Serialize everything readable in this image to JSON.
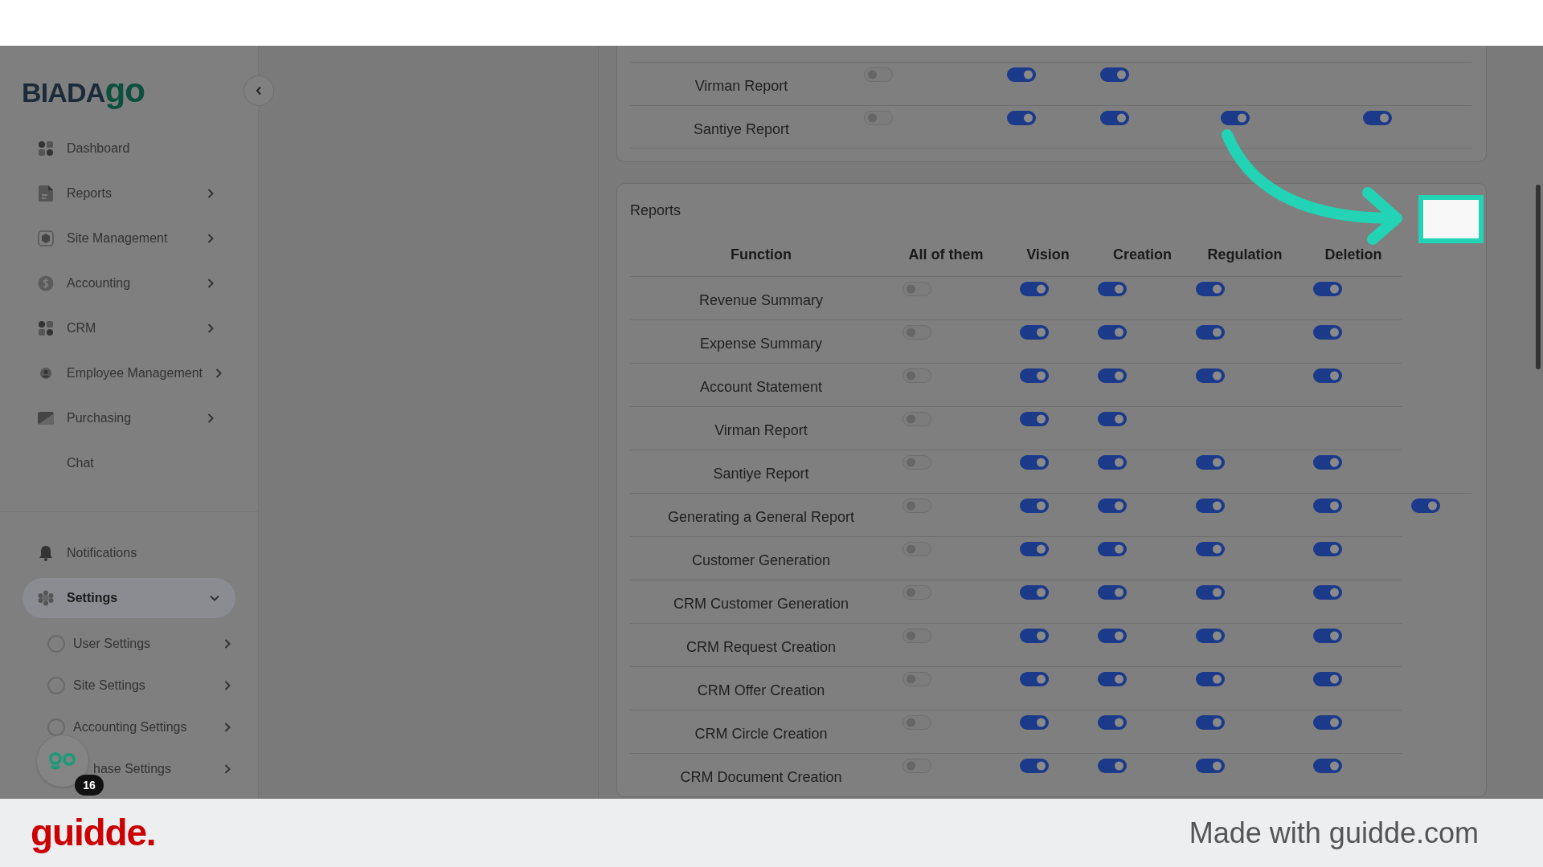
{
  "logo": {
    "text": "BIADA",
    "accent": "go"
  },
  "sidebar": {
    "items": [
      {
        "label": "Dashboard",
        "kind": "grid",
        "expandable": false
      },
      {
        "label": "Reports",
        "kind": "doc",
        "expandable": true
      },
      {
        "label": "Site Management",
        "kind": "box",
        "expandable": true
      },
      {
        "label": "Accounting",
        "kind": "dollar",
        "expandable": true
      },
      {
        "label": "CRM",
        "kind": "grid",
        "expandable": true
      },
      {
        "label": "Employee Management",
        "kind": "person",
        "expandable": true
      },
      {
        "label": "Purchasing",
        "kind": "tag",
        "expandable": true
      },
      {
        "label": "Chat",
        "kind": "plain",
        "expandable": false
      }
    ],
    "bottom_items": [
      {
        "label": "Notifications",
        "kind": "bell",
        "expanded": false,
        "selected": false
      },
      {
        "label": "Settings",
        "kind": "gear",
        "expanded": true,
        "selected": true
      }
    ],
    "sub_items": [
      {
        "label": "User Settings"
      },
      {
        "label": "Site Settings"
      },
      {
        "label": "Accounting Settings"
      },
      {
        "label": "hase Settings"
      }
    ],
    "chat_badge": "16"
  },
  "top_card": {
    "rows": [
      {
        "function": "Virman Report",
        "toggles": [
          {
            "on": false
          },
          {
            "on": true
          },
          {
            "on": true
          }
        ]
      },
      {
        "function": "Santiye Report",
        "toggles": [
          {
            "on": false
          },
          {
            "on": true
          },
          {
            "on": true
          },
          {
            "on": true
          },
          {
            "on": true
          }
        ]
      }
    ]
  },
  "reports_card": {
    "title": "Reports",
    "columns": [
      "Function",
      "All of them",
      "Vision",
      "Creation",
      "Regulation",
      "Deletion"
    ],
    "rows": [
      {
        "function": "Revenue Summary",
        "toggles": [
          {
            "on": false
          },
          {
            "on": true
          },
          {
            "on": true
          },
          {
            "on": true
          },
          {
            "on": true
          }
        ]
      },
      {
        "function": "Expense Summary",
        "toggles": [
          {
            "on": false
          },
          {
            "on": true
          },
          {
            "on": true
          },
          {
            "on": true
          },
          {
            "on": true
          }
        ]
      },
      {
        "function": "Account Statement",
        "toggles": [
          {
            "on": false
          },
          {
            "on": true
          },
          {
            "on": true
          },
          {
            "on": true
          },
          {
            "on": true
          }
        ]
      },
      {
        "function": "Virman Report",
        "toggles": [
          {
            "on": false
          },
          {
            "on": true
          },
          {
            "on": true
          }
        ]
      },
      {
        "function": "Santiye Report",
        "toggles": [
          {
            "on": false
          },
          {
            "on": true
          },
          {
            "on": true
          },
          {
            "on": true
          },
          {
            "on": true
          }
        ]
      },
      {
        "function": "Generating a General Report",
        "toggles": [
          {
            "on": false
          },
          {
            "on": true
          },
          {
            "on": true
          },
          {
            "on": true
          },
          {
            "on": true
          },
          {
            "on": true
          }
        ]
      },
      {
        "function": "Customer Generation",
        "toggles": [
          {
            "on": false
          },
          {
            "on": true
          },
          {
            "on": true
          },
          {
            "on": true
          },
          {
            "on": true
          }
        ]
      },
      {
        "function": "CRM Customer Generation",
        "toggles": [
          {
            "on": false
          },
          {
            "on": true
          },
          {
            "on": true
          },
          {
            "on": true
          },
          {
            "on": true
          }
        ]
      },
      {
        "function": "CRM Request Creation",
        "toggles": [
          {
            "on": false
          },
          {
            "on": true
          },
          {
            "on": true
          },
          {
            "on": true
          },
          {
            "on": true
          }
        ]
      },
      {
        "function": "CRM Offer Creation",
        "toggles": [
          {
            "on": false
          },
          {
            "on": true
          },
          {
            "on": true
          },
          {
            "on": true
          },
          {
            "on": true
          }
        ]
      },
      {
        "function": "CRM Circle Creation",
        "toggles": [
          {
            "on": false
          },
          {
            "on": true
          },
          {
            "on": true
          },
          {
            "on": true
          },
          {
            "on": true
          }
        ]
      },
      {
        "function": "CRM Document Creation",
        "toggles": [
          {
            "on": false
          },
          {
            "on": true
          },
          {
            "on": true
          },
          {
            "on": true
          },
          {
            "on": true
          }
        ]
      }
    ]
  },
  "footer": {
    "brand": "guidde.",
    "credit": "Made with guidde.com"
  }
}
